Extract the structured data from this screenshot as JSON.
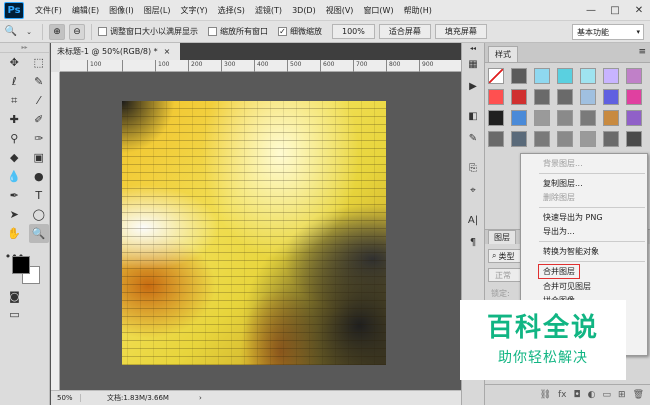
{
  "app": {
    "logo": "Ps"
  },
  "menu": [
    "文件(F)",
    "编辑(E)",
    "图像(I)",
    "图层(L)",
    "文字(Y)",
    "选择(S)",
    "滤镜(T)",
    "3D(D)",
    "视图(V)",
    "窗口(W)",
    "帮助(H)"
  ],
  "window_controls": {
    "minimize": "—",
    "maximize": "□",
    "close": "✕"
  },
  "options": {
    "resize_windows_label": "调整窗口大小以满屏显示",
    "resize_windows_checked": false,
    "zoom_all_windows_label": "缩放所有窗口",
    "zoom_all_windows_checked": false,
    "scrubby_zoom_label": "细微缩放",
    "scrubby_zoom_checked": true,
    "zoom_100": "100%",
    "fit_screen": "适合屏幕",
    "fill_screen": "填充屏幕",
    "workspace": "基本功能"
  },
  "document": {
    "tab_title": "未标题-1 @ 50%(RGB/8) *",
    "tab_close": "×",
    "ruler_labels": [
      "100",
      "100",
      "200",
      "300",
      "400",
      "500",
      "600",
      "700",
      "800",
      "900"
    ],
    "zoom": "50%",
    "doc_info": "文档:1.83M/3.66M"
  },
  "styles_panel": {
    "tab": "样式",
    "swatches": [
      "#ffffff",
      "#5b5b5b",
      "#8fd8f0",
      "#5ad0e0",
      "#9fe3f0",
      "#c8b4ff",
      "#c080c8",
      "#ff5050",
      "#d03030",
      "#6a6a6a",
      "#6a6a6a",
      "#a0c0e0",
      "#6060e0",
      "#e040a0",
      "#202020",
      "#4a8ad8",
      "#9a9a9a",
      "#8a8a8a",
      "#7a7a7a",
      "#c88a40",
      "#9060c8",
      "#6a6a6a",
      "#5a6a7a",
      "#7a7a7a",
      "#8a8a8a",
      "#9a9a9a",
      "#6a6a6a",
      "#4a4a4a"
    ]
  },
  "layers_panel": {
    "tab": "图层",
    "filter_label": "类型",
    "blend_mode": "正常",
    "lock_label": "锁定:"
  },
  "context_menu": {
    "items": [
      {
        "label": "背景图层...",
        "disabled": true
      },
      {
        "label": "复制图层...",
        "disabled": false
      },
      {
        "label": "删除图层",
        "disabled": true
      },
      {
        "label": "快速导出为 PNG",
        "disabled": false
      },
      {
        "label": "导出为...",
        "disabled": false
      },
      {
        "label": "转换为智能对象",
        "disabled": false
      },
      {
        "label": "合并图层",
        "disabled": false,
        "highlighted": true
      },
      {
        "label": "合并可见图层",
        "disabled": false
      },
      {
        "label": "拼合图像",
        "disabled": false
      }
    ]
  },
  "watermark": {
    "title": "百科全说",
    "subtitle": "助你轻松解决"
  }
}
